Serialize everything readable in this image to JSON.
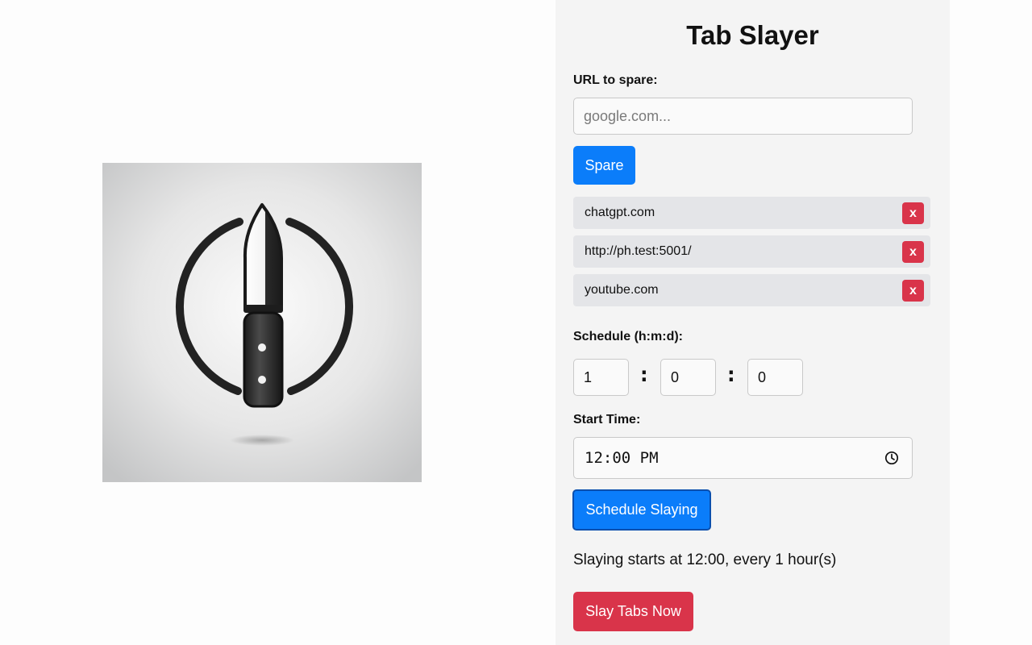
{
  "app": {
    "title": "Tab Slayer"
  },
  "spare": {
    "label": "URL to spare:",
    "placeholder": "google.com...",
    "value": "",
    "button_label": "Spare"
  },
  "spared_urls": [
    {
      "url": "chatgpt.com",
      "remove_label": "x"
    },
    {
      "url": "http://ph.test:5001/",
      "remove_label": "x"
    },
    {
      "url": "youtube.com",
      "remove_label": "x"
    }
  ],
  "schedule": {
    "label": "Schedule (h:m:d):",
    "hours": "1",
    "minutes": "0",
    "seconds": "0",
    "separator": ":"
  },
  "start_time": {
    "label": "Start Time:",
    "value": "12:00 PM",
    "icon": "clock-icon"
  },
  "schedule_button_label": "Schedule Slaying",
  "status_message": "Slaying starts at 12:00, every 1 hour(s)",
  "slay_now_label": "Slay Tabs Now",
  "logo": {
    "icon": "knife-in-circle-logo"
  },
  "colors": {
    "primary_blue": "#0b7dfa",
    "danger_red": "#d9344a",
    "panel_bg": "#f4f4f4",
    "list_item_bg": "#e4e5e8"
  }
}
